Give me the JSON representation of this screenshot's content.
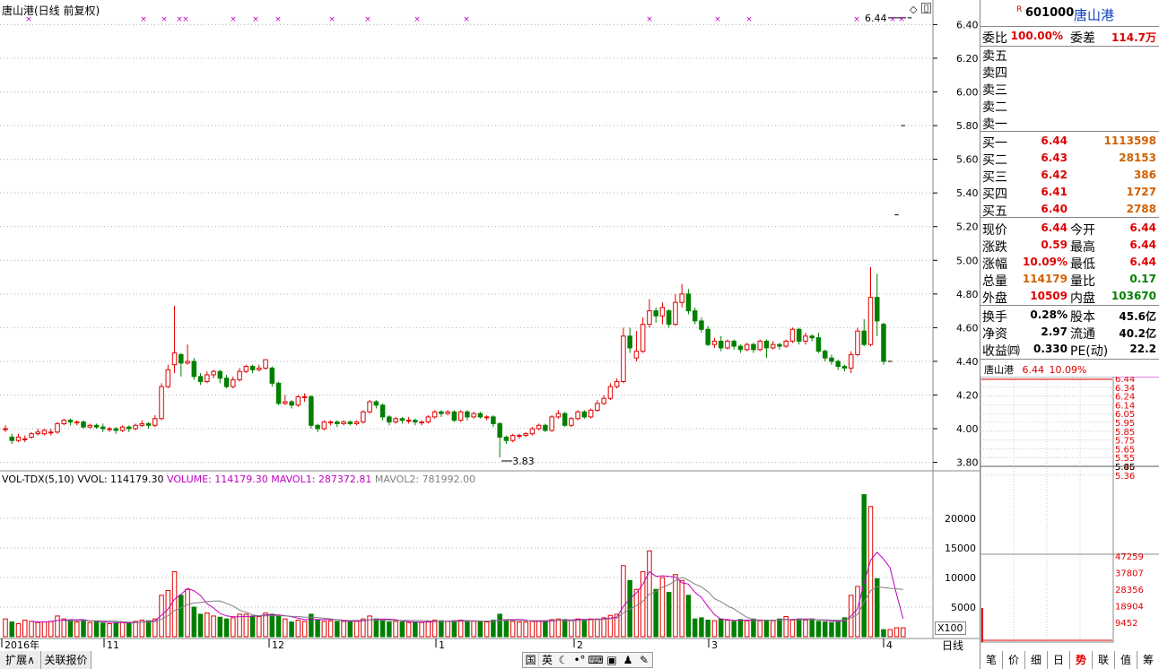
{
  "chart_header": {
    "title": "唐山港(日线 前复权)"
  },
  "price_axis": [
    "6.40",
    "6.20",
    "6.00",
    "5.80",
    "5.60",
    "5.40",
    "5.20",
    "5.00",
    "4.80",
    "4.60",
    "4.40",
    "4.20",
    "4.00",
    "3.80"
  ],
  "annotations": {
    "high_label": "6.44",
    "low_label": "3.83"
  },
  "volume_header": {
    "name": "VOL-TDX(5,10)",
    "vvol": "VVOL: 114179.30",
    "volume": "VOLUME: 114179.30",
    "mavol1": "MAVOL1: 287372.81",
    "mavol2": "MAVOL2: 781992.00"
  },
  "volume_axis": [
    "20000",
    "15000",
    "10000",
    "5000"
  ],
  "volume_unit": "X100",
  "date_axis": [
    "2016年",
    "11",
    "12",
    "1",
    "2",
    "3",
    "4"
  ],
  "period_label": "日线",
  "bottom_tabs": [
    "扩展∧",
    "关联报价"
  ],
  "toolbar_icons": [
    "国",
    "英",
    "moon-icon",
    "ellipsis-icon",
    "keyboard-icon",
    "shirt-icon",
    "person-icon",
    "wrench-icon"
  ],
  "quote": {
    "code": "601000",
    "name": "唐山港",
    "r_mark": "R",
    "wb_label": "委比",
    "wb_value": "100.00%",
    "wc_label": "委差",
    "wc_value": "114.7万",
    "sells": [
      "卖五",
      "卖四",
      "卖三",
      "卖二",
      "卖一"
    ],
    "buys": [
      {
        "label": "买一",
        "price": "6.44",
        "vol": "1113598"
      },
      {
        "label": "买二",
        "price": "6.43",
        "vol": "28153"
      },
      {
        "label": "买三",
        "price": "6.42",
        "vol": "386"
      },
      {
        "label": "买四",
        "price": "6.41",
        "vol": "1727"
      },
      {
        "label": "买五",
        "price": "6.40",
        "vol": "2788"
      }
    ],
    "stats": [
      {
        "l": "现价",
        "v": "6.44",
        "c": "red",
        "l2": "今开",
        "v2": "6.44",
        "c2": "red"
      },
      {
        "l": "涨跌",
        "v": "0.59",
        "c": "red",
        "l2": "最高",
        "v2": "6.44",
        "c2": "red"
      },
      {
        "l": "涨幅",
        "v": "10.09%",
        "c": "red",
        "l2": "最低",
        "v2": "6.44",
        "c2": "red"
      },
      {
        "l": "总量",
        "v": "114179",
        "c": "org",
        "l2": "量比",
        "v2": "0.17",
        "c2": "grn"
      },
      {
        "l": "外盘",
        "v": "10509",
        "c": "red",
        "l2": "内盘",
        "v2": "103670",
        "c2": "grn"
      }
    ],
    "stats2": [
      {
        "l": "换手",
        "v": "0.28%",
        "l2": "股本",
        "v2": "45.6亿"
      },
      {
        "l": "净资",
        "v": "2.97",
        "l2": "流通",
        "v2": "40.2亿"
      },
      {
        "l": "收益㈣",
        "v": "0.330",
        "l2": "PE(动)",
        "v2": "22.2"
      }
    ],
    "mini_header": {
      "name": "唐山港",
      "price": "6.44",
      "pct": "10.09%"
    },
    "mini_price_axis": [
      "6.44",
      "6.34",
      "6.24",
      "6.14",
      "6.05",
      "5.95",
      "5.85",
      "5.75",
      "5.65",
      "5.55",
      "5.46",
      "5.36"
    ],
    "mini_vol_axis": [
      "47259",
      "37807",
      "28356",
      "18904",
      "9452"
    ],
    "tabs": [
      "笔",
      "价",
      "细",
      "日",
      "势",
      "联",
      "值",
      "筹"
    ],
    "active_tab": "势"
  },
  "chart_data": {
    "type": "candlestick",
    "ylim": [
      3.75,
      6.45
    ],
    "candles": [
      [
        4.0,
        4.0,
        3.98,
        4.02
      ],
      [
        3.95,
        3.93,
        3.91,
        3.97
      ],
      [
        3.93,
        3.95,
        3.92,
        3.97
      ],
      [
        3.94,
        3.94,
        3.92,
        3.96
      ],
      [
        3.95,
        3.97,
        3.94,
        3.98
      ],
      [
        3.97,
        3.98,
        3.96,
        4.0
      ],
      [
        3.97,
        3.99,
        3.96,
        4.0
      ],
      [
        3.98,
        3.98,
        3.96,
        4.0
      ],
      [
        3.98,
        4.03,
        3.97,
        4.04
      ],
      [
        4.03,
        4.05,
        4.02,
        4.06
      ],
      [
        4.05,
        4.04,
        4.02,
        4.06
      ],
      [
        4.04,
        4.04,
        4.02,
        4.05
      ],
      [
        4.04,
        4.01,
        4.0,
        4.05
      ],
      [
        4.01,
        4.02,
        4.0,
        4.03
      ],
      [
        4.02,
        4.01,
        4.0,
        4.03
      ],
      [
        4.01,
        4.0,
        3.98,
        4.03
      ],
      [
        4.0,
        4.0,
        3.98,
        4.01
      ],
      [
        4.0,
        3.99,
        3.97,
        4.01
      ],
      [
        3.99,
        4.01,
        3.98,
        4.02
      ],
      [
        4.01,
        4.0,
        3.98,
        4.02
      ],
      [
        4.0,
        4.02,
        3.99,
        4.03
      ],
      [
        4.02,
        4.03,
        4.01,
        4.05
      ],
      [
        4.03,
        4.02,
        4.0,
        4.04
      ],
      [
        4.02,
        4.06,
        4.01,
        4.08
      ],
      [
        4.06,
        4.25,
        4.05,
        4.27
      ],
      [
        4.25,
        4.35,
        4.24,
        4.38
      ],
      [
        4.38,
        4.45,
        4.33,
        4.73
      ],
      [
        4.44,
        4.39,
        4.31,
        4.45
      ],
      [
        4.39,
        4.4,
        4.38,
        4.5
      ],
      [
        4.4,
        4.31,
        4.29,
        4.42
      ],
      [
        4.31,
        4.28,
        4.26,
        4.33
      ],
      [
        4.28,
        4.32,
        4.27,
        4.34
      ],
      [
        4.32,
        4.34,
        4.3,
        4.35
      ],
      [
        4.34,
        4.3,
        4.27,
        4.35
      ],
      [
        4.3,
        4.25,
        4.24,
        4.32
      ],
      [
        4.25,
        4.29,
        4.24,
        4.31
      ],
      [
        4.29,
        4.34,
        4.28,
        4.36
      ],
      [
        4.34,
        4.37,
        4.33,
        4.38
      ],
      [
        4.37,
        4.35,
        4.33,
        4.38
      ],
      [
        4.35,
        4.36,
        4.34,
        4.38
      ],
      [
        4.36,
        4.41,
        4.35,
        4.41
      ],
      [
        4.36,
        4.27,
        4.25,
        4.37
      ],
      [
        4.27,
        4.15,
        4.14,
        4.28
      ],
      [
        4.15,
        4.16,
        4.14,
        4.2
      ],
      [
        4.16,
        4.14,
        4.12,
        4.17
      ],
      [
        4.14,
        4.19,
        4.13,
        4.2
      ],
      [
        4.19,
        4.19,
        4.16,
        4.21
      ],
      [
        4.19,
        4.02,
        4.0,
        4.2
      ],
      [
        4.02,
        4.0,
        3.98,
        4.03
      ],
      [
        4.0,
        4.04,
        3.99,
        4.05
      ],
      [
        4.04,
        4.04,
        4.02,
        4.05
      ],
      [
        4.04,
        4.03,
        4.01,
        4.05
      ],
      [
        4.03,
        4.04,
        4.02,
        4.05
      ],
      [
        4.04,
        4.03,
        4.02,
        4.05
      ],
      [
        4.03,
        4.04,
        4.02,
        4.05
      ],
      [
        4.04,
        4.1,
        4.03,
        4.11
      ],
      [
        4.1,
        4.16,
        4.09,
        4.17
      ],
      [
        4.16,
        4.14,
        4.12,
        4.17
      ],
      [
        4.14,
        4.07,
        4.05,
        4.15
      ],
      [
        4.07,
        4.04,
        4.02,
        4.08
      ],
      [
        4.04,
        4.06,
        4.03,
        4.07
      ],
      [
        4.06,
        4.05,
        4.03,
        4.07
      ],
      [
        4.05,
        4.05,
        4.03,
        4.07
      ],
      [
        4.05,
        4.04,
        4.02,
        4.06
      ],
      [
        4.04,
        4.04,
        4.02,
        4.05
      ],
      [
        4.04,
        4.07,
        4.03,
        4.08
      ],
      [
        4.07,
        4.1,
        4.06,
        4.11
      ],
      [
        4.1,
        4.09,
        4.07,
        4.11
      ],
      [
        4.09,
        4.1,
        4.08,
        4.11
      ],
      [
        4.1,
        4.05,
        4.04,
        4.11
      ],
      [
        4.05,
        4.1,
        4.04,
        4.11
      ],
      [
        4.1,
        4.07,
        4.05,
        4.11
      ],
      [
        4.07,
        4.09,
        4.06,
        4.1
      ],
      [
        4.09,
        4.07,
        4.06,
        4.1
      ],
      [
        4.07,
        4.07,
        4.05,
        4.08
      ],
      [
        4.07,
        4.03,
        4.01,
        4.08
      ],
      [
        4.03,
        3.95,
        3.83,
        4.04
      ],
      [
        3.95,
        3.93,
        3.91,
        3.96
      ],
      [
        3.93,
        3.96,
        3.92,
        3.97
      ],
      [
        3.96,
        3.96,
        3.94,
        3.97
      ],
      [
        3.96,
        3.97,
        3.95,
        3.98
      ],
      [
        3.97,
        4.0,
        3.96,
        4.01
      ],
      [
        4.0,
        4.02,
        3.99,
        4.03
      ],
      [
        4.02,
        3.99,
        3.98,
        4.03
      ],
      [
        3.99,
        4.07,
        3.98,
        4.08
      ],
      [
        4.07,
        4.09,
        4.06,
        4.11
      ],
      [
        4.09,
        4.02,
        4.01,
        4.1
      ],
      [
        4.02,
        4.06,
        4.01,
        4.07
      ],
      [
        4.06,
        4.1,
        4.05,
        4.11
      ],
      [
        4.1,
        4.07,
        4.06,
        4.11
      ],
      [
        4.07,
        4.11,
        4.06,
        4.12
      ],
      [
        4.11,
        4.15,
        4.1,
        4.17
      ],
      [
        4.15,
        4.18,
        4.14,
        4.2
      ],
      [
        4.18,
        4.25,
        4.17,
        4.27
      ],
      [
        4.25,
        4.28,
        4.24,
        4.3
      ],
      [
        4.28,
        4.55,
        4.27,
        4.6
      ],
      [
        4.55,
        4.48,
        4.45,
        4.6
      ],
      [
        4.42,
        4.46,
        4.4,
        4.58
      ],
      [
        4.46,
        4.62,
        4.45,
        4.66
      ],
      [
        4.62,
        4.7,
        4.6,
        4.77
      ],
      [
        4.7,
        4.67,
        4.63,
        4.72
      ],
      [
        4.67,
        4.72,
        4.62,
        4.75
      ],
      [
        4.7,
        4.62,
        4.6,
        4.71
      ],
      [
        4.62,
        4.75,
        4.61,
        4.8
      ],
      [
        4.75,
        4.8,
        4.72,
        4.86
      ],
      [
        4.8,
        4.7,
        4.68,
        4.83
      ],
      [
        4.7,
        4.64,
        4.62,
        4.72
      ],
      [
        4.64,
        4.59,
        4.57,
        4.66
      ],
      [
        4.59,
        4.5,
        4.49,
        4.61
      ],
      [
        4.5,
        4.52,
        4.48,
        4.54
      ],
      [
        4.52,
        4.48,
        4.46,
        4.55
      ],
      [
        4.48,
        4.52,
        4.47,
        4.53
      ],
      [
        4.52,
        4.49,
        4.47,
        4.53
      ],
      [
        4.49,
        4.47,
        4.45,
        4.5
      ],
      [
        4.47,
        4.5,
        4.46,
        4.51
      ],
      [
        4.5,
        4.47,
        4.45,
        4.51
      ],
      [
        4.47,
        4.52,
        4.46,
        4.53
      ],
      [
        4.52,
        4.48,
        4.42,
        4.53
      ],
      [
        4.48,
        4.5,
        4.47,
        4.52
      ],
      [
        4.5,
        4.49,
        4.47,
        4.51
      ],
      [
        4.49,
        4.52,
        4.48,
        4.53
      ],
      [
        4.52,
        4.59,
        4.51,
        4.6
      ],
      [
        4.59,
        4.52,
        4.5,
        4.6
      ],
      [
        4.52,
        4.55,
        4.5,
        4.57
      ],
      [
        4.55,
        4.54,
        4.52,
        4.56
      ],
      [
        4.54,
        4.46,
        4.45,
        4.57
      ],
      [
        4.46,
        4.42,
        4.4,
        4.47
      ],
      [
        4.42,
        4.4,
        4.38,
        4.44
      ],
      [
        4.4,
        4.37,
        4.35,
        4.41
      ],
      [
        4.37,
        4.36,
        4.34,
        4.38
      ],
      [
        4.36,
        4.44,
        4.33,
        4.46
      ],
      [
        4.44,
        4.58,
        4.43,
        4.6
      ],
      [
        4.58,
        4.5,
        4.49,
        4.65
      ],
      [
        4.5,
        4.78,
        4.49,
        4.96
      ],
      [
        4.78,
        4.64,
        4.55,
        4.92
      ],
      [
        4.62,
        4.4,
        4.38,
        4.63
      ],
      [
        4.4,
        4.4,
        4.4,
        4.4
      ],
      [
        5.27,
        5.27,
        5.27,
        5.27
      ],
      [
        5.8,
        5.8,
        5.8,
        5.8
      ],
      [
        6.44,
        6.44,
        6.44,
        6.44
      ]
    ],
    "volumes": [
      3000,
      2500,
      2200,
      2800,
      2600,
      2400,
      2500,
      2600,
      3500,
      3000,
      2800,
      2500,
      2700,
      2400,
      2600,
      2300,
      2200,
      2400,
      2500,
      2300,
      2600,
      2800,
      2700,
      3000,
      7000,
      7800,
      11000,
      7000,
      8000,
      5000,
      3800,
      4000,
      3500,
      3300,
      3000,
      3200,
      3800,
      3800,
      3500,
      3400,
      4000,
      3800,
      3600,
      3000,
      2500,
      2800,
      2600,
      3800,
      2800,
      2600,
      2700,
      2600,
      2600,
      2500,
      2600,
      3000,
      3500,
      3000,
      2800,
      2500,
      2600,
      2500,
      2400,
      2500,
      2400,
      2600,
      2800,
      2700,
      2600,
      2700,
      2800,
      2700,
      2600,
      2500,
      2500,
      2800,
      3800,
      2800,
      2600,
      2500,
      2500,
      2600,
      2700,
      2600,
      2900,
      3000,
      2900,
      2800,
      3000,
      2900,
      3000,
      3000,
      3200,
      3600,
      3800,
      12000,
      9500,
      8000,
      11000,
      14500,
      8000,
      10000,
      7500,
      10500,
      9500,
      7000,
      3000,
      3200,
      2800,
      2700,
      3000,
      2800,
      2600,
      2900,
      2700,
      3000,
      2700,
      2800,
      2700,
      3000,
      3400,
      2800,
      3000,
      2800,
      3000,
      2600,
      2500,
      2400,
      2500,
      3200,
      7000,
      8500,
      24000,
      22000,
      9800,
      1200,
      1200,
      1500,
      1500
    ]
  }
}
